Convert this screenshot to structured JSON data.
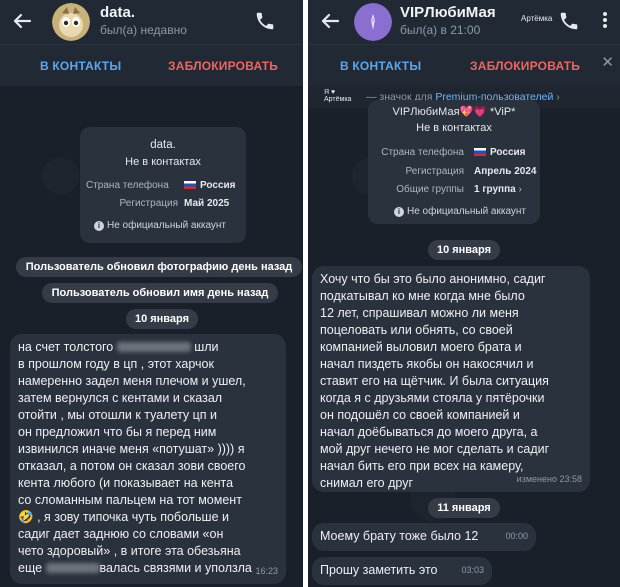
{
  "left": {
    "contact": {
      "name": "data.",
      "status": "был(а) недавно"
    },
    "actions": {
      "add": "В КОНТАКТЫ",
      "block": "ЗАБЛОКИРОВАТЬ"
    },
    "info_card": {
      "name": "data.",
      "not_in_contacts": "Не в контактах",
      "phone_country_label": "Страна телефона",
      "phone_country_value": "Россия",
      "registration_label": "Регистрация",
      "registration_value": "Май 2025",
      "unofficial": "Не официальный аккаунт"
    },
    "service_messages": [
      "Пользователь обновил фотографию день назад",
      "Пользователь обновил имя день назад"
    ],
    "date_divider": "10 января",
    "message": {
      "lines": [
        "на счет толстого",
        "в прошлом году в цп , этот харчок",
        "намеренно задел меня плечом и ушел,",
        "затем вернулся с кентами и сказал",
        "отойти , мы отошли к туалету цп и",
        "он предложил что бы я перед ним",
        "извинился иначе меня «потушат» )))) я",
        "отказал, а потом он сказал зови своего",
        "кента любого (и показывает на кента",
        "со сломанным пальцем на тот момент",
        ", я зову типочка чуть побольше и",
        "садиг дает заднюю со словами «он",
        "чето здоровый» , в итоге эта обезьяна",
        "еще",
        "валась связями и уползла"
      ],
      "line1_tail": "шли",
      "emoji": "🤣",
      "time": "16:23"
    }
  },
  "right": {
    "contact": {
      "name": "VIPЛюбиМая",
      "status": "был(а) в 21:00",
      "mini_badge": "Артёмка"
    },
    "actions": {
      "add": "В КОНТАКТЫ",
      "block": "ЗАБЛОКИРОВАТЬ",
      "close": "✕"
    },
    "premium_banner": {
      "badge": "Я ♥ Артёмка",
      "text": " — значок для ",
      "link": "Premium-пользователей",
      "chevron": "›"
    },
    "info_card": {
      "name": "VIPЛюбиМая💖💗 *ViP*",
      "not_in_contacts": "Не в контактах",
      "phone_country_label": "Страна телефона",
      "phone_country_value": "Россия",
      "registration_label": "Регистрация",
      "registration_value": "Апрель 2024",
      "groups_label": "Общие группы",
      "groups_value": "1 группа",
      "unofficial": "Не официальный аккаунт"
    },
    "date_divider_1": "10 января",
    "message_1": {
      "lines": [
        "Хочу что бы это было анонимно, садиг",
        "подкатывал ко мне когда мне было",
        "12 лет, спрашивал можно ли меня",
        "поцеловать или обнять, со своей",
        "компанией выловил моего брата и",
        "начал пиздеть якобы он накосячил и",
        "ставит его на щётчик. И была ситуация",
        "когда я с друзьями стояла у пятёрочки",
        "он подошёл со своей компанией и",
        "начал доёбываться до моего друга, а",
        "мой друг нечего не мог сделать и садиг",
        "начал бить его при всех на камеру,",
        "снимал его друг"
      ],
      "time": "изменено 23:58"
    },
    "date_divider_2": "11 января",
    "message_2": {
      "text": "Моему брату тоже было 12",
      "time": "00:00"
    },
    "message_3": {
      "text": "Прошу заметить это",
      "time": "03:03"
    }
  },
  "colors": {
    "chat_bg": "#1a2029",
    "header_bg": "#212934",
    "bubble_bg": "#2a323d",
    "accent_blue": "#5aa8f0",
    "danger_red": "#f0655f",
    "muted": "#8f99a6"
  },
  "icons": [
    "back-arrow-icon",
    "phone-icon",
    "more-vertical-icon",
    "close-icon",
    "info-icon",
    "russia-flag-icon",
    "chevron-right-icon"
  ]
}
